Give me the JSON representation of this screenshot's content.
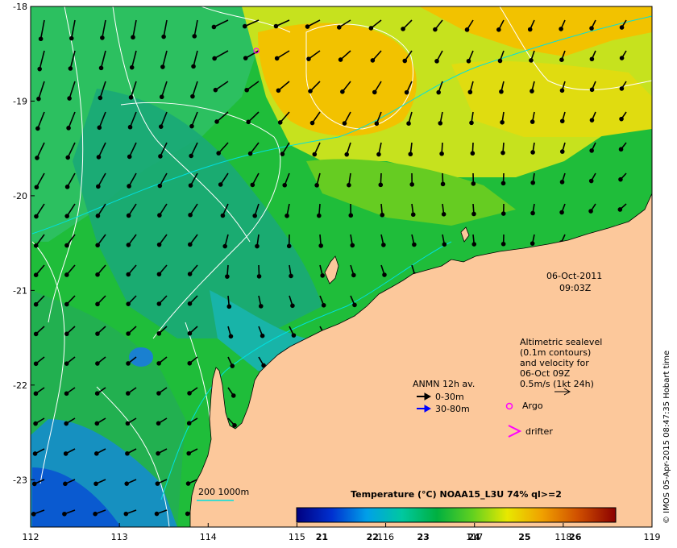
{
  "axes": {
    "x_ticks": [
      "112",
      "113",
      "114",
      "115",
      "116",
      "117",
      "118",
      "119"
    ],
    "y_ticks": [
      "-18",
      "-19",
      "-20",
      "-21",
      "-22",
      "-23"
    ],
    "x_range": [
      112,
      119
    ],
    "y_range": [
      -23.5,
      -18
    ]
  },
  "datetime": {
    "date": "06-Oct-2011",
    "time": "09:03Z"
  },
  "velocity_note": {
    "lines": [
      "Altimetric sealevel",
      "(0.1m contours)",
      "and velocity for",
      "06-Oct 09Z",
      "0.5m/s (1kt 24h)"
    ]
  },
  "legend": {
    "anmn_title": "ANMN 12h av.",
    "depth_shallow": "0-30m",
    "depth_deep": "30-80m",
    "argo": "Argo",
    "drifter": "drifter",
    "isobath": "200  1000m",
    "colors": {
      "depth_shallow": "#000000",
      "depth_deep": "#0000ff",
      "argo": "#ff00ff",
      "drifter": "#ff00ff",
      "isobath": "#00e0e0"
    }
  },
  "colorbar": {
    "title": "Temperature (°C) NOAA15_L3U 74% ql>=2",
    "labels": [
      "21",
      "22",
      "23",
      "24",
      "25",
      "26"
    ],
    "range": [
      20.5,
      26.8
    ],
    "stops": [
      "#000080",
      "#0030d0",
      "#00a0e8",
      "#00c8a0",
      "#00b040",
      "#60d020",
      "#e8e800",
      "#f0a000",
      "#d05000",
      "#8b0000"
    ]
  },
  "credit": "© IMOS 05-Apr-2015 08:47:35 Hobart time",
  "land_color": "#fcc89b"
}
